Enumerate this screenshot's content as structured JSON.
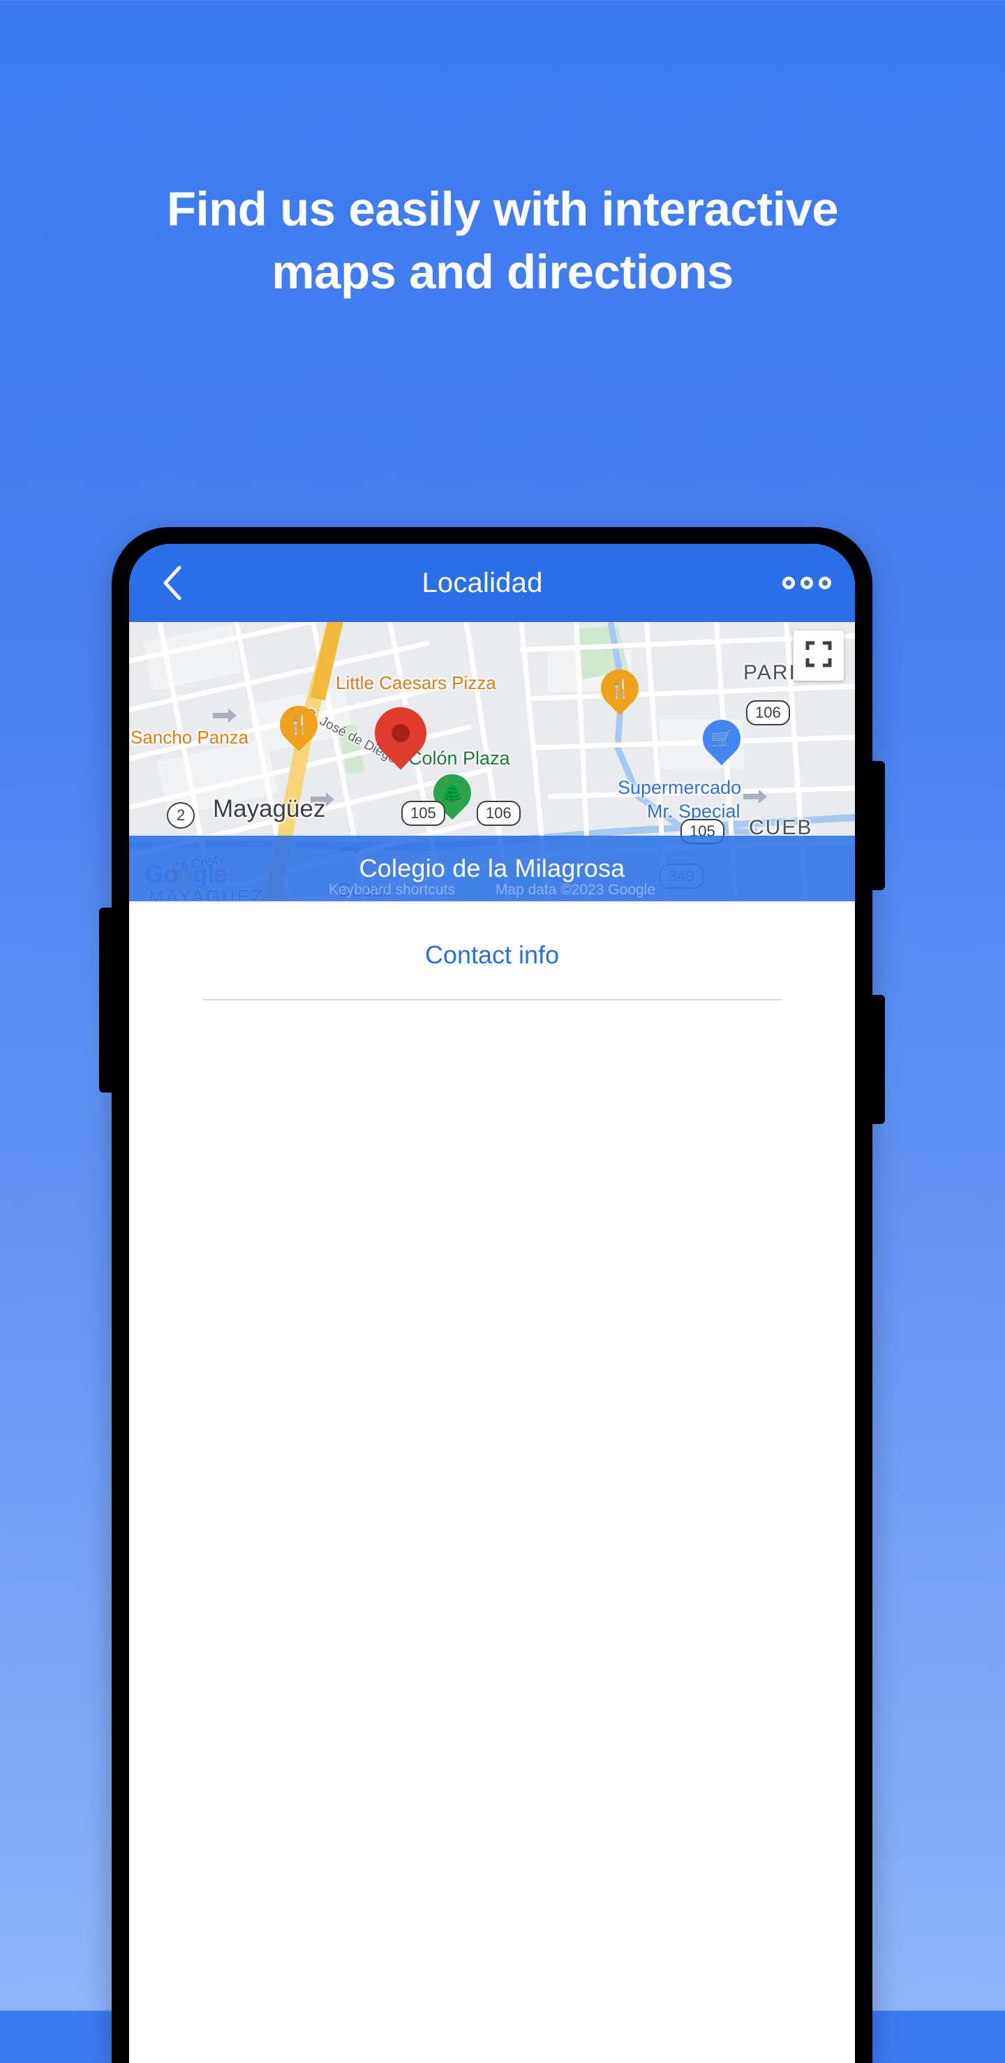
{
  "hero": {
    "headline": "Find us easily with interactive maps and directions"
  },
  "phone": {
    "appbar": {
      "back_icon": "chevron-left-icon",
      "title": "Localidad",
      "menu_icon": "overflow-menu-icon"
    },
    "map": {
      "fullscreen_icon": "fullscreen-icon",
      "watermark": "Google",
      "watermark_letters": [
        "G",
        "o",
        "o",
        "g",
        "l",
        "e"
      ],
      "overlay_title": "Colegio de la Milagrosa",
      "attribution": {
        "keyboard_shortcuts": "Keyboard shortcuts",
        "map_data": "Map data ©2023 Google"
      },
      "labels": [
        {
          "text": "Sancho Panza",
          "kind": "poi-orange"
        },
        {
          "text": "Little Caesars Pizza",
          "kind": "poi-orange"
        },
        {
          "text": "Colón Plaza",
          "kind": "poi-green"
        },
        {
          "text": "Supermercado",
          "kind": "poi-blue"
        },
        {
          "text": "Mr. Special",
          "kind": "poi-blue"
        },
        {
          "text": "Mayagüez",
          "kind": "city"
        },
        {
          "text": "PARI",
          "kind": "area"
        },
        {
          "text": "CUEB",
          "kind": "area"
        },
        {
          "text": "C. José de Diego",
          "kind": "street"
        },
        {
          "text": "Cll Cristy",
          "kind": "street"
        },
        {
          "text": "Bocar",
          "kind": "street"
        },
        {
          "text": "MAYAGÜEZ",
          "kind": "street"
        }
      ],
      "markers": [
        {
          "name": "restaurant-pin-sancho-panza",
          "icon": "restaurant-icon",
          "color": "#f0a21c"
        },
        {
          "name": "restaurant-pin-little-caesars",
          "icon": "restaurant-icon",
          "color": "#f0a21c"
        },
        {
          "name": "location-pin-primary",
          "icon": "place-icon",
          "color": "#e03b2f"
        },
        {
          "name": "park-pin-colon-plaza",
          "icon": "tree-icon",
          "color": "#2ba24c"
        },
        {
          "name": "grocery-pin-mr-special",
          "icon": "shopping-cart-icon",
          "color": "#4285f4"
        }
      ],
      "road_shields": [
        "2",
        "105",
        "106",
        "106",
        "105",
        "349"
      ]
    },
    "content": {
      "contact_link": "Contact info"
    }
  },
  "colors": {
    "background_top": "#3b7af0",
    "background_bottom": "#8fb4f8",
    "appbar": "#2b6fe8",
    "accent_link": "#2b6fe8",
    "marker_red": "#e03b2f",
    "marker_orange": "#f0a21c",
    "marker_green": "#2ba24c",
    "marker_blue": "#4285f4"
  }
}
